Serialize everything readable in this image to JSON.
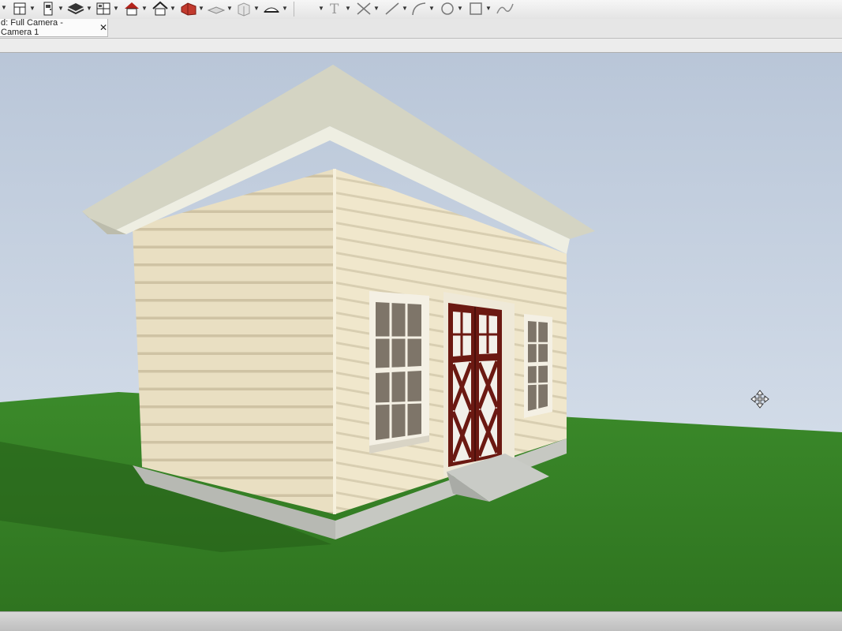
{
  "toolbar": {
    "tools": [
      {
        "icon": "cabinet-icon"
      },
      {
        "icon": "door-icon"
      },
      {
        "icon": "layers-stack-icon"
      },
      {
        "icon": "window-icon"
      },
      {
        "icon": "roof-house-icon"
      },
      {
        "icon": "house-outline-icon"
      },
      {
        "icon": "building-3d-icon"
      },
      {
        "icon": "wall-pattern-icon"
      },
      {
        "icon": "box-3d-icon"
      },
      {
        "icon": "slab-icon"
      },
      {
        "icon": "text-tool-icon"
      },
      {
        "icon": "dimension-x-icon"
      },
      {
        "icon": "line-tool-icon"
      },
      {
        "icon": "arc-tool-icon"
      },
      {
        "icon": "circle-tool-icon"
      },
      {
        "icon": "rectangle-tool-icon"
      },
      {
        "icon": "spline-tool-icon"
      }
    ]
  },
  "tabs": [
    {
      "label": "d: Full Camera - Camera 1",
      "close": "✕",
      "active": true
    }
  ],
  "viewport": {
    "scene": "3D rendered camera view of a single-room shed with shed roof, siding, two double-hung windows, double doors and a ramp",
    "colors": {
      "sky": "#c9d6e6",
      "grass": "#3f8a2c",
      "siding": "#ece2c6",
      "roof": "#dcdccc",
      "door": "#6b1a12",
      "foundation": "#b9bcb6"
    }
  },
  "cursor": {
    "icon": "move-cursor-icon"
  }
}
